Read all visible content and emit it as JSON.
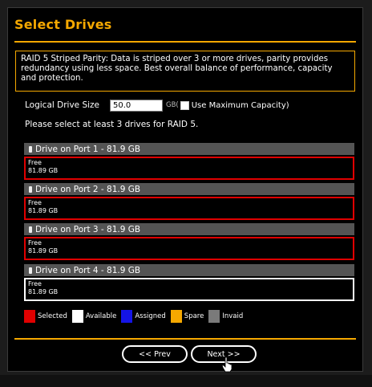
{
  "page": {
    "title": "Select Drives",
    "description": "RAID 5 Striped Parity: Data is striped over 3 or more drives, parity provides redundancy using less space. Best overall balance of performance, capacity and protection."
  },
  "logical_size": {
    "label": "Logical Drive Size",
    "value": "50.0",
    "unit": "GB(",
    "checkbox_label": "Use Maximum Capacity)",
    "checkbox_checked": false
  },
  "hint": "Please select at least 3 drives for RAID 5.",
  "drives": [
    {
      "header": "Drive on Port 1 - 81.9 GB",
      "status": "Free",
      "size": "81.89 GB",
      "state": "Selected"
    },
    {
      "header": "Drive on Port 2 - 81.9 GB",
      "status": "Free",
      "size": "81.89 GB",
      "state": "Selected"
    },
    {
      "header": "Drive on Port 3 - 81.9 GB",
      "status": "Free",
      "size": "81.89 GB",
      "state": "Selected"
    },
    {
      "header": "Drive on Port 4 - 81.9 GB",
      "status": "Free",
      "size": "81.89 GB",
      "state": "Available"
    }
  ],
  "legend": [
    {
      "label": "Selected",
      "color": "#e00000"
    },
    {
      "label": "Available",
      "color": "#ffffff"
    },
    {
      "label": "Assigned",
      "color": "#1414e6"
    },
    {
      "label": "Spare",
      "color": "#f5a800"
    },
    {
      "label": "Invaid",
      "color": "#7a7a7a"
    }
  ],
  "buttons": {
    "prev": "<< Prev",
    "next": "Next >>"
  },
  "colors": {
    "accent": "#f5a800",
    "selected_border": "#e00000",
    "available_border": "#ffffff"
  }
}
